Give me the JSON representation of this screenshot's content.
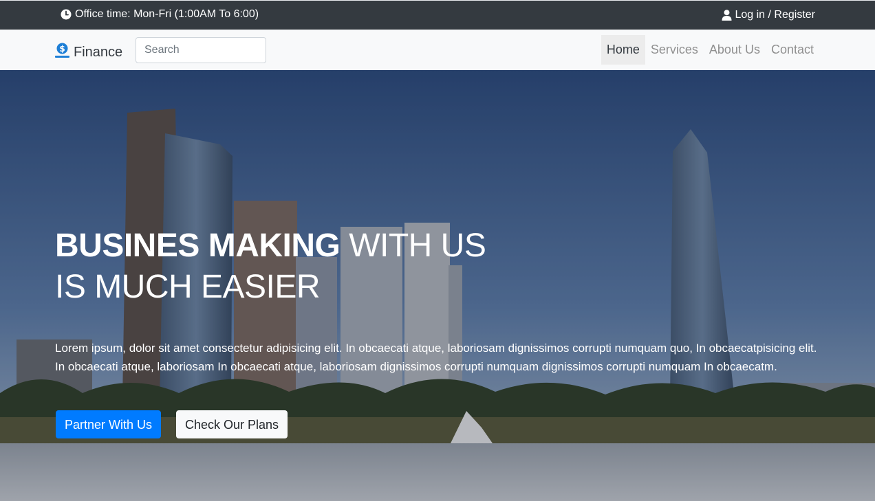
{
  "topbar": {
    "office_time": "Office time: Mon-Fri (1:00AM To 6:00)",
    "login": "Log in / Register",
    "clock_icon": "clock-icon",
    "user_icon": "user-icon"
  },
  "navbar": {
    "brand": "Finance",
    "brand_icon": "dollar-coin-icon",
    "search_placeholder": "Search",
    "links": [
      {
        "label": "Home",
        "active": true
      },
      {
        "label": "Services",
        "active": false
      },
      {
        "label": "About Us",
        "active": false
      },
      {
        "label": "Contact",
        "active": false
      }
    ]
  },
  "hero": {
    "headline_bold": "BUSINES MAKING",
    "headline_rest": " WITH US",
    "headline_line2": "IS MUCH EASIER",
    "lead": "Lorem ipsum, dolor sit amet consectetur adipisicing elit. In obcaecati atque, laboriosam dignissimos corrupti numquam quo, In obcaecatpisicing elit. In obcaecati atque, laboriosam In obcaecati atque, laboriosam dignissimos corrupti numquam dignissimos corrupti numquam In obcaecatm.",
    "primary_button": "Partner With Us",
    "secondary_button": "Check Our Plans"
  },
  "colors": {
    "topbar_bg": "#343a40",
    "navbar_bg": "#f8f9fa",
    "primary": "#007bff",
    "brand_icon": "#1e7fd6"
  }
}
